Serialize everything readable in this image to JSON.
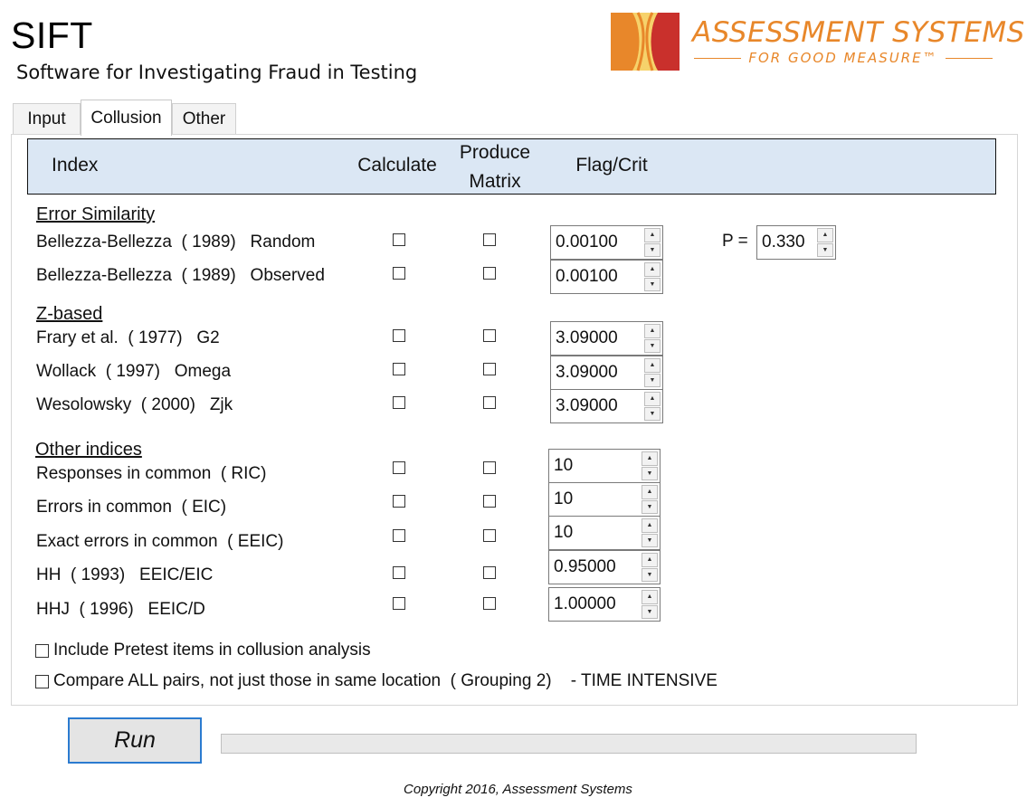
{
  "app": {
    "title": "SIFT",
    "subtitle": "Software for Investigating Fraud in Testing",
    "logo": {
      "name": "ASSESSMENT SYSTEMS",
      "tagline": "FOR GOOD MEASURE™",
      "color": "#e8872a"
    }
  },
  "tabs": [
    {
      "label": "Input",
      "active": false
    },
    {
      "label": "Collusion",
      "active": true
    },
    {
      "label": "Other",
      "active": false
    }
  ],
  "table_header": {
    "index": "Index",
    "calculate": "Calculate",
    "produce_matrix_1": "Produce",
    "produce_matrix_2": "Matrix",
    "flag_crit": "Flag/Crit",
    "bg_color": "#dbe7f4"
  },
  "sections": {
    "error_similarity": "Error Similarity",
    "z_based": "Z-based",
    "other_indices": "Other indices"
  },
  "rows": [
    {
      "label": "Bellezza-Bellezza  ( 1989)   Random",
      "calculate": false,
      "matrix": false,
      "value": "0.00100"
    },
    {
      "label": "Bellezza-Bellezza  ( 1989)   Observed",
      "calculate": false,
      "matrix": false,
      "value": "0.00100"
    },
    {
      "label": "Frary et al.  ( 1977)   G2",
      "calculate": false,
      "matrix": false,
      "value": "3.09000"
    },
    {
      "label": "Wollack  ( 1997)   Omega",
      "calculate": false,
      "matrix": false,
      "value": "3.09000"
    },
    {
      "label": "Wesolowsky  ( 2000)   Zjk",
      "calculate": false,
      "matrix": false,
      "value": "3.09000"
    },
    {
      "label": "Responses in common  ( RIC)",
      "calculate": false,
      "matrix": false,
      "value": "10"
    },
    {
      "label": "Errors in common  ( EIC)",
      "calculate": false,
      "matrix": false,
      "value": "10"
    },
    {
      "label": "Exact errors in common  ( EEIC)",
      "calculate": false,
      "matrix": false,
      "value": "10"
    },
    {
      "label": "HH  ( 1993)   EEIC/EIC",
      "calculate": false,
      "matrix": false,
      "value": "0.95000"
    },
    {
      "label": "HHJ  ( 1996)   EEIC/D",
      "calculate": false,
      "matrix": false,
      "value": "1.00000"
    }
  ],
  "p_field": {
    "label": "P =",
    "value": "0.330"
  },
  "spin_icons": {
    "up": "up-arrow-icon",
    "down": "down-arrow-icon"
  },
  "options": {
    "pretest": {
      "label": "Include Pretest items in collusion analysis",
      "checked": false
    },
    "all_pairs": {
      "label": "Compare ALL pairs, not just those in same location  ( Grouping 2)    - TIME INTENSIVE",
      "checked": false
    }
  },
  "run_button": "Run",
  "progress": 0,
  "copyright": "Copyright 2016, Assessment Systems"
}
